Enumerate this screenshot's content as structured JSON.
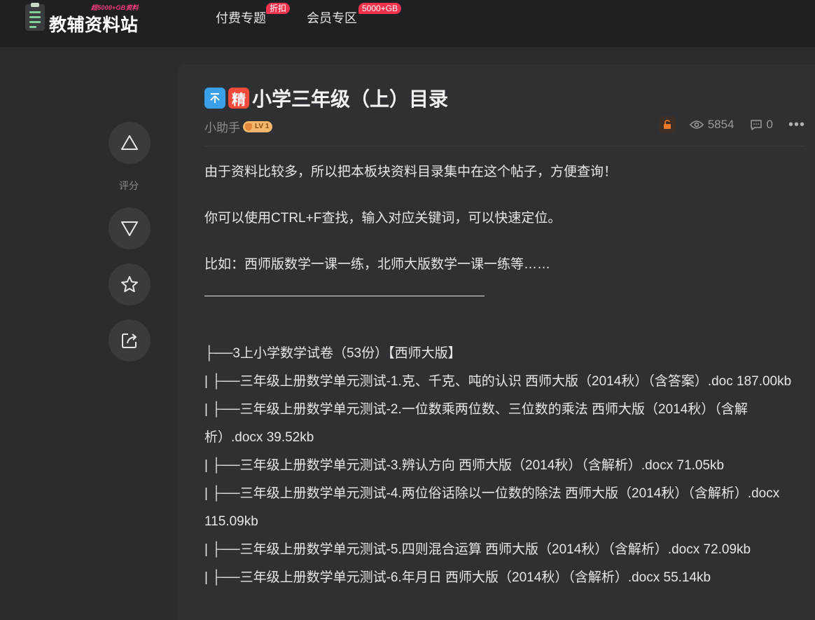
{
  "header": {
    "logo_sub": "超5000+GB资料",
    "logo_title": "教辅资料站",
    "nav": [
      {
        "label": "付费专题",
        "badge": "折扣"
      },
      {
        "label": "会员专区",
        "badge": "5000+GB"
      }
    ]
  },
  "actions": {
    "rate_label": "评分"
  },
  "post": {
    "tag_jing": "精",
    "title": "小学三年级（上）目录",
    "author": "小助手",
    "level": "LV 1",
    "views": "5854",
    "comments": "0",
    "more": "•••",
    "paragraphs": [
      "由于资料比较多，所以把本板块资料目录集中在这个帖子，方便查询！",
      "你可以使用CTRL+F查找，输入对应关键词，可以快速定位。",
      "比如：西师版数学一课一练，北师大版数学一课一练等……"
    ],
    "tree": [
      "├──3上小学数学试卷（53份）【西师大版】",
      "| ├──三年级上册数学单元测试-1.克、千克、吨的认识 西师大版（2014秋）（含答案）.doc 187.00kb",
      "| ├──三年级上册数学单元测试-2.一位数乘两位数、三位数的乘法 西师大版（2014秋）（含解析）.docx 39.52kb",
      "| ├──三年级上册数学单元测试-3.辨认方向 西师大版（2014秋）（含解析）.docx 71.05kb",
      "| ├──三年级上册数学单元测试-4.两位俗话除以一位数的除法 西师大版（2014秋）（含解析）.docx 115.09kb",
      "| ├──三年级上册数学单元测试-5.四则混合运算 西师大版（2014秋）（含解析）.docx 72.09kb",
      "| ├──三年级上册数学单元测试-6.年月日 西师大版（2014秋）（含解析）.docx 55.14kb"
    ]
  }
}
